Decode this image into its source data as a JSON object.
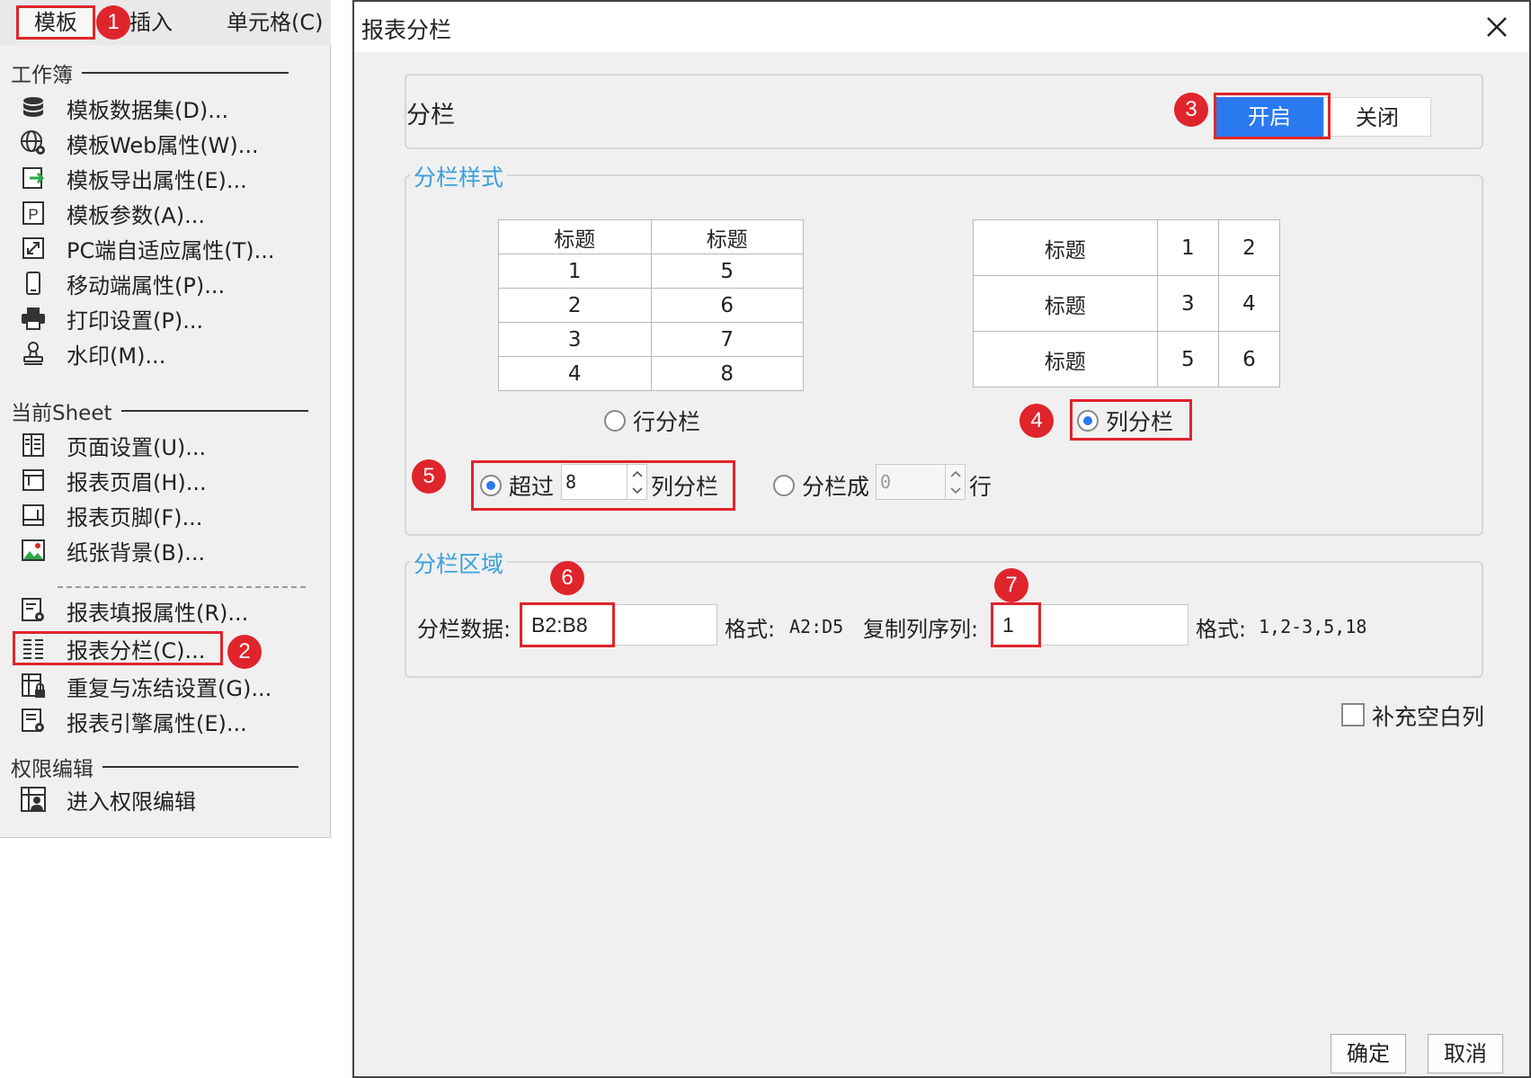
{
  "menu": {
    "menubar": {
      "template": "模板",
      "insert": "插入",
      "cell": "单元格(C)"
    },
    "groups": {
      "workbook": "工作簿",
      "current_sheet": "当前Sheet",
      "permission": "权限编辑"
    },
    "items": [
      {
        "label": "模板数据集(D)...",
        "icon": "database-icon"
      },
      {
        "label": "模板Web属性(W)...",
        "icon": "globe-gear-icon"
      },
      {
        "label": "模板导出属性(E)...",
        "icon": "export-icon"
      },
      {
        "label": "模板参数(A)...",
        "icon": "parameter-p-icon"
      },
      {
        "label": "PC端自适应属性(T)...",
        "icon": "resize-icon"
      },
      {
        "label": "移动端属性(P)...",
        "icon": "mobile-icon"
      },
      {
        "label": "打印设置(P)...",
        "icon": "printer-icon"
      },
      {
        "label": "水印(M)...",
        "icon": "stamp-icon"
      },
      {
        "label": "页面设置(U)...",
        "icon": "page-setup-icon"
      },
      {
        "label": "报表页眉(H)...",
        "icon": "header-icon"
      },
      {
        "label": "报表页脚(F)...",
        "icon": "footer-icon"
      },
      {
        "label": "纸张背景(B)...",
        "icon": "image-icon"
      },
      {
        "label": "报表填报属性(R)...",
        "icon": "form-gear-icon"
      },
      {
        "label": "报表分栏(C)...",
        "icon": "columns-icon"
      },
      {
        "label": "重复与冻结设置(G)...",
        "icon": "freeze-lock-icon"
      },
      {
        "label": "报表引擎属性(E)...",
        "icon": "engine-gear-icon"
      },
      {
        "label": "进入权限编辑",
        "icon": "permission-user-icon"
      }
    ]
  },
  "badges": [
    "1",
    "2",
    "3",
    "4",
    "5",
    "6",
    "7"
  ],
  "dialog": {
    "title": "报表分栏",
    "column": {
      "label": "分栏",
      "on": "开启",
      "off": "关闭"
    },
    "style": {
      "title": "分栏样式",
      "row_preview": {
        "headers": [
          "标题",
          "标题"
        ],
        "rows": [
          [
            "1",
            "5"
          ],
          [
            "2",
            "6"
          ],
          [
            "3",
            "7"
          ],
          [
            "4",
            "8"
          ]
        ]
      },
      "col_preview": {
        "rows": [
          [
            "标题",
            "1",
            "2"
          ],
          [
            "标题",
            "3",
            "4"
          ],
          [
            "标题",
            "5",
            "6"
          ]
        ]
      },
      "row_option": "行分栏",
      "col_option": "列分栏",
      "exceed": {
        "prefix": "超过",
        "value": "8",
        "suffix": "列分栏"
      },
      "split_into": {
        "prefix": "分栏成",
        "value": "0",
        "suffix": "行"
      }
    },
    "area": {
      "title": "分栏区域",
      "data_label": "分栏数据:",
      "data_value": "B2:B8",
      "format1_label": "格式:",
      "format1_value": "A2:D5",
      "copy_label": "复制列序列:",
      "copy_value": "1",
      "format2_label": "格式:",
      "format2_value": "1,2-3,5,18"
    },
    "fill_blank": "补充空白列",
    "ok": "确定",
    "cancel": "取消"
  },
  "colors": {
    "accent": "#2b79ef",
    "highlight": "#e0242b",
    "section": "#3aa0dc"
  }
}
